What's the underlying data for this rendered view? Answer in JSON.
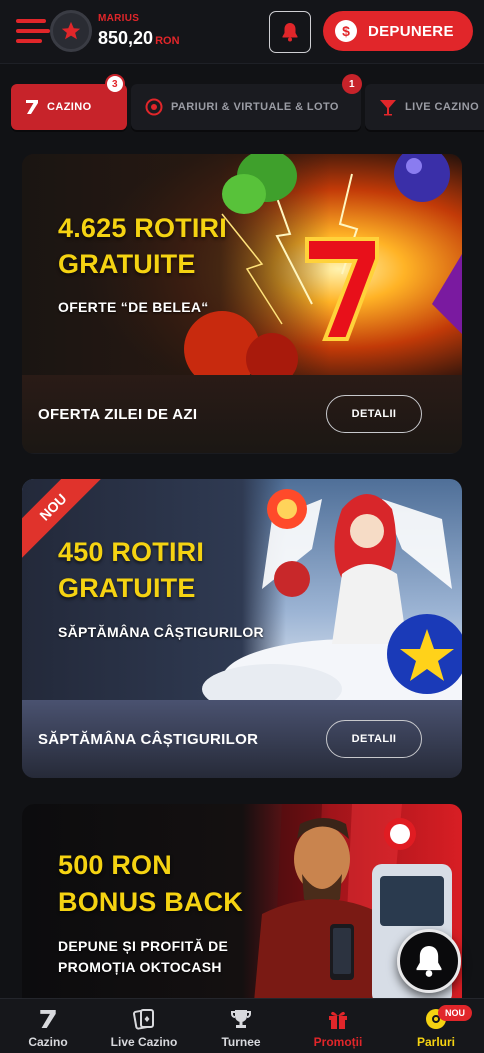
{
  "header": {
    "username": "MARIUS",
    "balance_amount": "850,20",
    "balance_currency": "RON",
    "deposit_label": "DEPUNERE",
    "deposit_icon": "$"
  },
  "tabs": [
    {
      "label": "CAZINO",
      "badge": "3",
      "icon": "seven-icon",
      "active": true
    },
    {
      "label": "PARIURI & VIRTUALE & LOTO",
      "badge": "1",
      "icon": "football-icon",
      "active": false
    },
    {
      "label": "LIVE CAZINO",
      "badge": "",
      "icon": "cocktail-icon",
      "active": false
    }
  ],
  "promos": [
    {
      "hero_title_line1": "4.625 ROTIRI",
      "hero_title_line2": "GRATUITE",
      "hero_subtitle": "OFERTE “DE BELEA“",
      "footer_title": "OFERTA ZILEI DE AZI",
      "details_label": "DETALII"
    },
    {
      "ribbon": "NOU",
      "hero_title_line1": "450 ROTIRI",
      "hero_title_line2": "GRATUITE",
      "hero_subtitle": "SĂPTĂMÂNA CÂȘTIGURILOR",
      "footer_title": "SĂPTĂMÂNA CÂȘTIGURILOR",
      "details_label": "DETALII"
    },
    {
      "hero_title_line1": "500 RON",
      "hero_title_line2": "BONUS BACK",
      "hero_subtitle_line1": "DEPUNE ȘI PROFITĂ DE",
      "hero_subtitle_line2": "PROMOȚIA OKTOCASH"
    }
  ],
  "bottom_nav": {
    "items": [
      {
        "label": "Cazino",
        "icon": "seven-icon"
      },
      {
        "label": "Live Cazino",
        "icon": "cards-icon"
      },
      {
        "label": "Turnee",
        "icon": "trophy-icon"
      },
      {
        "label": "Promoții",
        "icon": "gift-icon",
        "active": true
      },
      {
        "label": "Parluri",
        "icon": "football-icon"
      }
    ],
    "new_badge": "NOU"
  },
  "colors": {
    "brand_red": "#e1262a",
    "promo_yellow": "#f5d312",
    "background": "#111215"
  }
}
